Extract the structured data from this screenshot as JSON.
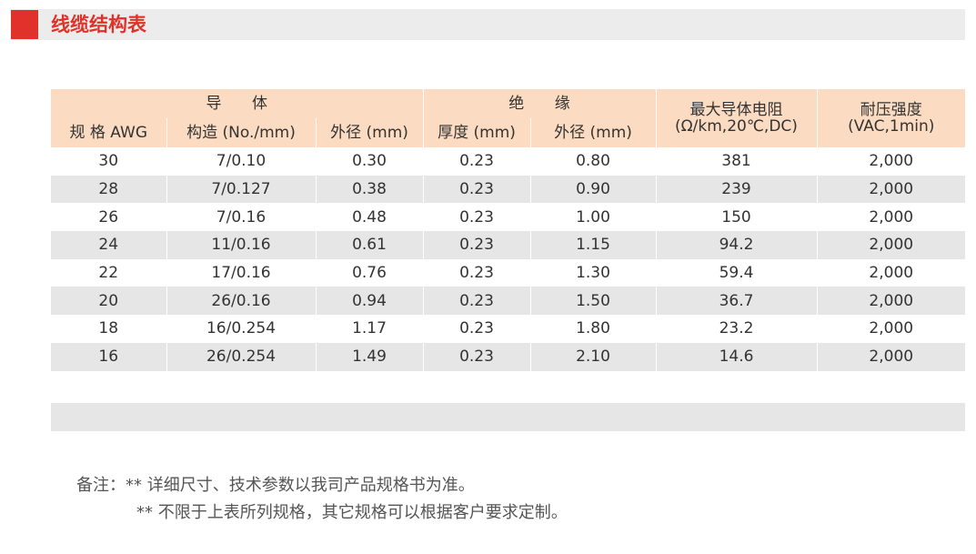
{
  "title": "线缆结构表",
  "colors": {
    "accent": "#e0322b",
    "header_bg": "#fbdcc2",
    "stripe_bg": "#e6e6e6",
    "title_bar_bg": "#ececec"
  },
  "table": {
    "groups": {
      "conductor": "导 体",
      "insulation": "绝 缘",
      "resistance": "最大导体电阻",
      "resistance_unit": "(Ω/km,20℃,DC)",
      "voltage": "耐压强度",
      "voltage_unit": "(VAC,1min)"
    },
    "columns": {
      "awg": "规 格 AWG",
      "construction": "构造 (No./mm)",
      "conductor_od": "外径 (mm)",
      "thickness": "厚度 (mm)",
      "insulation_od": "外径 (mm)"
    },
    "rows": [
      [
        "30",
        "7/0.10",
        "0.30",
        "0.23",
        "0.80",
        "381",
        "2,000"
      ],
      [
        "28",
        "7/0.127",
        "0.38",
        "0.23",
        "0.90",
        "239",
        "2,000"
      ],
      [
        "26",
        "7/0.16",
        "0.48",
        "0.23",
        "1.00",
        "150",
        "2,000"
      ],
      [
        "24",
        "11/0.16",
        "0.61",
        "0.23",
        "1.15",
        "94.2",
        "2,000"
      ],
      [
        "22",
        "17/0.16",
        "0.76",
        "0.23",
        "1.30",
        "59.4",
        "2,000"
      ],
      [
        "20",
        "26/0.16",
        "0.94",
        "0.23",
        "1.50",
        "36.7",
        "2,000"
      ],
      [
        "18",
        "16/0.254",
        "1.17",
        "0.23",
        "1.80",
        "23.2",
        "2,000"
      ],
      [
        "16",
        "26/0.254",
        "1.49",
        "0.23",
        "2.10",
        "14.6",
        "2,000"
      ]
    ]
  },
  "notes": {
    "line1": "备注：** 详细尺寸、技术参数以我司产品规格书为准。",
    "line2": "** 不限于上表所列规格，其它规格可以根据客户要求定制。"
  }
}
